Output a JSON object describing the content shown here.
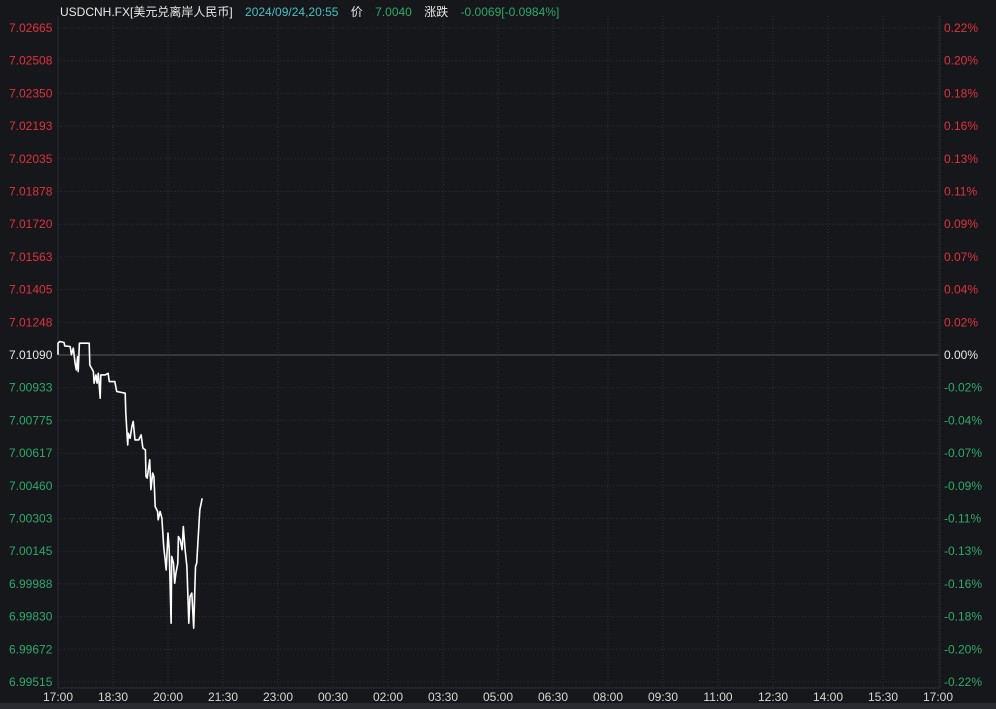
{
  "header": {
    "symbol": "USDCNH.FX[美元兑离岸人民币]",
    "datetime": "2024/09/24,20:55",
    "price_label": "价",
    "price": "7.0040",
    "change_label": "涨跌",
    "change": "-0.0069[-0.0984%]"
  },
  "colors": {
    "background": "#16171b",
    "up": "#e0323c",
    "down": "#2fa86b",
    "line": "#ffffff",
    "neutral": "#e8e8e8",
    "datetime": "#4bbfc4"
  },
  "chart_data": {
    "type": "line",
    "title": "USDCNH.FX[美元兑离岸人民币]",
    "prev_close": 7.0109,
    "ylim": [
      6.99515,
      7.02665
    ],
    "x_unit": "minutes since 17:00",
    "xlim": [
      0,
      1440
    ],
    "y_ticks": [
      "7.02665",
      "7.02508",
      "7.02350",
      "7.02193",
      "7.02035",
      "7.01878",
      "7.01720",
      "7.01563",
      "7.01405",
      "7.01248",
      "7.01090",
      "7.00933",
      "7.00775",
      "7.00617",
      "7.00460",
      "7.00303",
      "7.00145",
      "6.99988",
      "6.99830",
      "6.99672",
      "6.99515"
    ],
    "pct_ticks": [
      "0.22%",
      "0.20%",
      "0.18%",
      "0.16%",
      "0.13%",
      "0.11%",
      "0.09%",
      "0.07%",
      "0.04%",
      "0.02%",
      "0.00%",
      "-0.02%",
      "-0.04%",
      "-0.07%",
      "-0.09%",
      "-0.11%",
      "-0.13%",
      "-0.16%",
      "-0.18%",
      "-0.20%",
      "-0.22%"
    ],
    "x_ticks": [
      "17:00",
      "18:30",
      "20:00",
      "21:30",
      "23:00",
      "00:30",
      "02:00",
      "03:30",
      "05:00",
      "06:30",
      "08:00",
      "09:30",
      "11:00",
      "12:30",
      "14:00",
      "15:30",
      "17:00"
    ],
    "grid": true,
    "series": [
      {
        "name": "USDCNH",
        "x": [
          0,
          0,
          3,
          10,
          11,
          20,
          22,
          25,
          28,
          30,
          32,
          33,
          35,
          51,
          52,
          55,
          58,
          59,
          62,
          64,
          66,
          69,
          70,
          77,
          82,
          84,
          93,
          96,
          110,
          111,
          114,
          115,
          118,
          121,
          123,
          126,
          132,
          136,
          139,
          143,
          144,
          146,
          150,
          152,
          155,
          157,
          159,
          163,
          164,
          167,
          170,
          173,
          177,
          180,
          182,
          185,
          186,
          189,
          191,
          193,
          196,
          197,
          200,
          203,
          205,
          208,
          211,
          214,
          216,
          219,
          222,
          225,
          227,
          232,
          236
        ],
        "y": [
          7.01091,
          7.01147,
          7.01155,
          7.0115,
          7.01134,
          7.01131,
          7.01091,
          7.01123,
          7.0105,
          7.01018,
          7.01082,
          7.0101,
          7.01147,
          7.01147,
          7.01042,
          7.01026,
          7.0101,
          7.00954,
          7.00994,
          7.00954,
          7.01002,
          7.00882,
          7.00994,
          7.00994,
          7.01002,
          7.00962,
          7.00962,
          7.00914,
          7.00906,
          7.0081,
          7.00657,
          7.00713,
          7.00689,
          7.00746,
          7.0077,
          7.00681,
          7.00681,
          7.00705,
          7.00641,
          7.00633,
          7.00505,
          7.00497,
          7.00585,
          7.00441,
          7.00521,
          7.00505,
          7.0036,
          7.00336,
          7.00296,
          7.00336,
          7.00304,
          7.00168,
          7.00055,
          7.00232,
          7.00152,
          6.99798,
          7.0012,
          7.00087,
          6.99991,
          7.00039,
          7.00087,
          7.00216,
          7.002,
          7.00152,
          7.00264,
          7.00152,
          7.00071,
          6.99798,
          6.99927,
          6.99943,
          6.99774,
          7.00071,
          7.00087,
          7.00344,
          7.004
        ]
      }
    ]
  }
}
